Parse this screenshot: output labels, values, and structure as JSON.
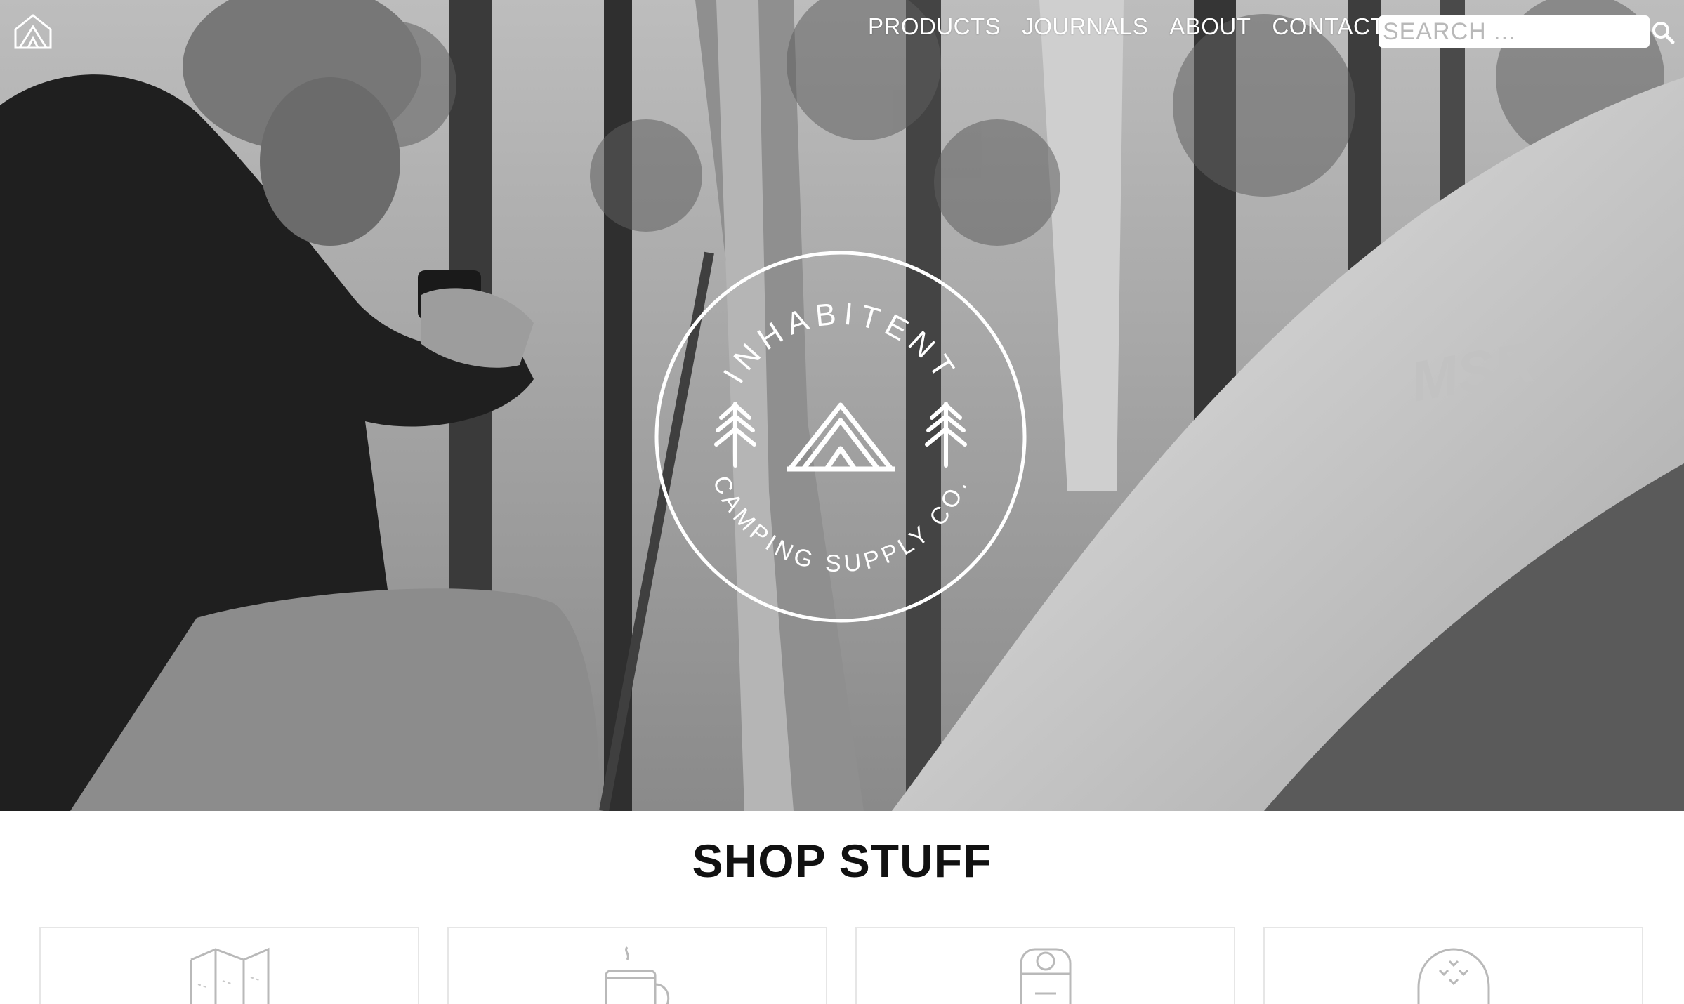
{
  "nav": {
    "items": [
      {
        "label": "PRODUCTS"
      },
      {
        "label": "JOURNALS"
      },
      {
        "label": "ABOUT"
      },
      {
        "label": "CONTACT"
      }
    ]
  },
  "search": {
    "placeholder": "SEARCH ..."
  },
  "hero": {
    "badge": {
      "top_text": "INHABITENT",
      "bottom_text": "CAMPING SUPPLY CO.",
      "tent_brand": "MSR"
    }
  },
  "shop": {
    "title": "SHOP STUFF",
    "cards": [
      {
        "icon": "map-icon"
      },
      {
        "icon": "mug-icon"
      },
      {
        "icon": "sleeping-bag-icon"
      },
      {
        "icon": "beanie-icon"
      }
    ]
  }
}
